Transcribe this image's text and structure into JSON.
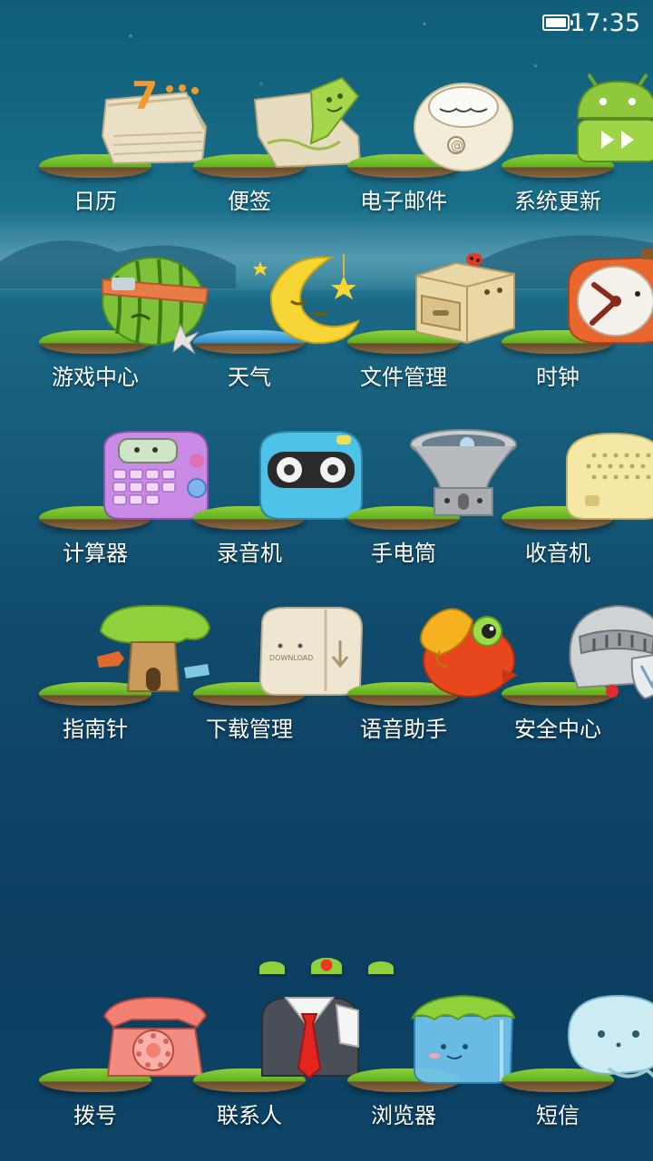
{
  "status_bar": {
    "time": "17:35",
    "battery_icon": "battery-full-icon"
  },
  "apps": [
    {
      "label": "日历",
      "icon": "calendar-icon",
      "badge": "7"
    },
    {
      "label": "便签",
      "icon": "notes-icon"
    },
    {
      "label": "电子邮件",
      "icon": "email-icon"
    },
    {
      "label": "系统更新",
      "icon": "system-update-icon"
    },
    {
      "label": "游戏中心",
      "icon": "game-center-icon"
    },
    {
      "label": "天气",
      "icon": "weather-icon"
    },
    {
      "label": "文件管理",
      "icon": "file-manager-icon"
    },
    {
      "label": "时钟",
      "icon": "clock-icon"
    },
    {
      "label": "计算器",
      "icon": "calculator-icon"
    },
    {
      "label": "录音机",
      "icon": "recorder-icon"
    },
    {
      "label": "手电筒",
      "icon": "flashlight-icon"
    },
    {
      "label": "收音机",
      "icon": "radio-icon"
    },
    {
      "label": "指南针",
      "icon": "compass-icon"
    },
    {
      "label": "下载管理",
      "icon": "download-manager-icon",
      "box_text": "DOWNLOAD"
    },
    {
      "label": "语音助手",
      "icon": "voice-assistant-icon"
    },
    {
      "label": "安全中心",
      "icon": "security-center-icon"
    }
  ],
  "page_indicator": {
    "count": 3,
    "active": 1
  },
  "dock": [
    {
      "label": "拨号",
      "icon": "phone-icon"
    },
    {
      "label": "联系人",
      "icon": "contacts-icon"
    },
    {
      "label": "浏览器",
      "icon": "browser-icon"
    },
    {
      "label": "短信",
      "icon": "messages-icon"
    }
  ],
  "colors": {
    "background_top": "#0f5d78",
    "background_bottom": "#0d4466",
    "grass": "#8fd13a",
    "label_text": "#ffffff"
  }
}
